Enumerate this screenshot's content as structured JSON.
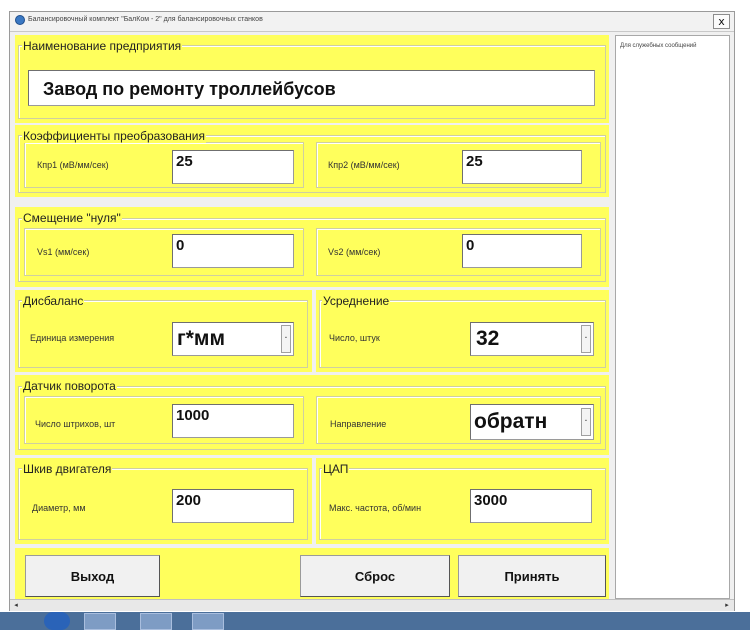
{
  "window": {
    "title": "Балансировочный комплект \"БалКом - 2\" для балансировочных станков",
    "close_label": "x"
  },
  "company": {
    "legend": "Наименование предприятия",
    "value": "Завод по ремонту троллейбусов"
  },
  "coefficients": {
    "legend": "Коэффициенты преобразования",
    "k1_label": "Кпр1 (мВ/мм/сек)",
    "k1_value": "25",
    "k2_label": "Кпр2 (мВ/мм/сек)",
    "k2_value": "25"
  },
  "zero_offset": {
    "legend": "Смещение \"нуля\"",
    "v1_label": "Vs1 (мм/сек)",
    "v1_value": "0",
    "v2_label": "Vs2 (мм/сек)",
    "v2_value": "0"
  },
  "imbalance": {
    "legend": "Дисбаланс",
    "unit_label": "Единица измерения",
    "unit_value": "г*мм"
  },
  "averaging": {
    "legend": "Усреднение",
    "count_label": "Число, штук",
    "count_value": "32"
  },
  "rotation_sensor": {
    "legend": "Датчик поворота",
    "strokes_label": "Число штрихов, шт",
    "strokes_value": "1000",
    "direction_label": "Направление",
    "direction_value": "обратн"
  },
  "pulley": {
    "legend": "Шкив двигателя",
    "diameter_label": "Диаметр, мм",
    "diameter_value": "200"
  },
  "dac": {
    "legend": "ЦАП",
    "max_freq_label": "Макс. частота, об/мин",
    "max_freq_value": "3000"
  },
  "buttons": {
    "exit": "Выход",
    "reset": "Сброс",
    "accept": "Принять"
  },
  "side_panel": {
    "text": "Для служебных сообщений"
  },
  "colors": {
    "panel_yellow": "#ffff5c",
    "window_bg": "#f0f0f0"
  }
}
